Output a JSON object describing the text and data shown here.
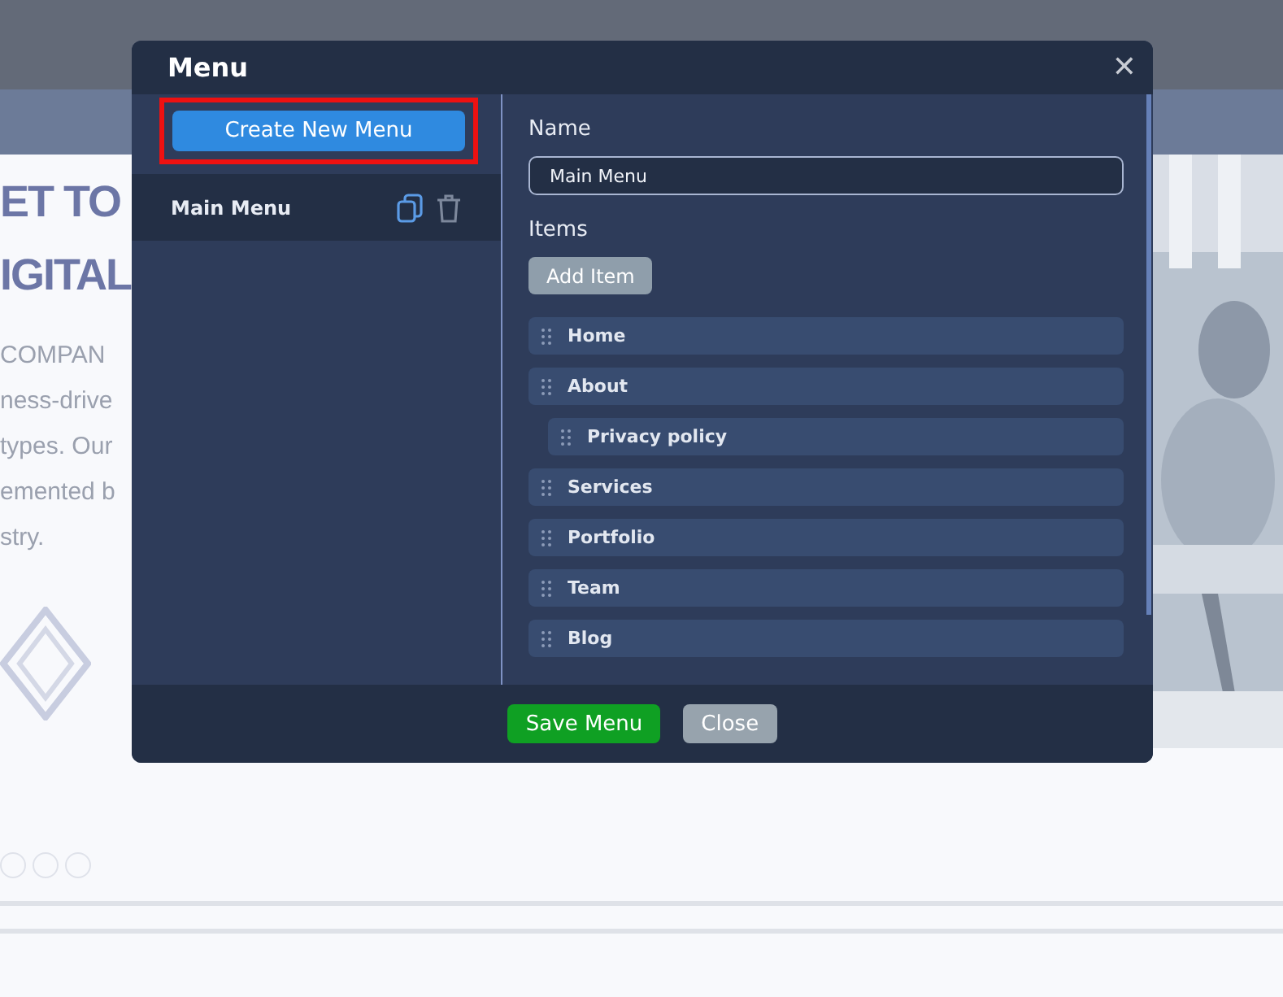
{
  "background": {
    "headline": [
      "ET TO",
      "IGITAL"
    ],
    "paragraph": [
      "COMPAN",
      "ness-drive",
      "types. Our",
      "emented b",
      "stry."
    ]
  },
  "dialog": {
    "title": "Menu",
    "close": "✕",
    "create_button": "Create New Menu",
    "menus": [
      {
        "name": "Main Menu",
        "selected": true
      }
    ],
    "name_label": "Name",
    "name_value": "Main Menu",
    "items_label": "Items",
    "add_button": "Add Item",
    "items": [
      {
        "label": "Home"
      },
      {
        "label": "About",
        "children": [
          {
            "label": "Privacy policy"
          }
        ]
      },
      {
        "label": "Services"
      },
      {
        "label": "Portfolio"
      },
      {
        "label": "Team"
      },
      {
        "label": "Blog"
      }
    ],
    "buttons": [
      {
        "label": "Save Menu",
        "kind": "primary"
      },
      {
        "label": "Close",
        "kind": "secondary"
      }
    ]
  }
}
